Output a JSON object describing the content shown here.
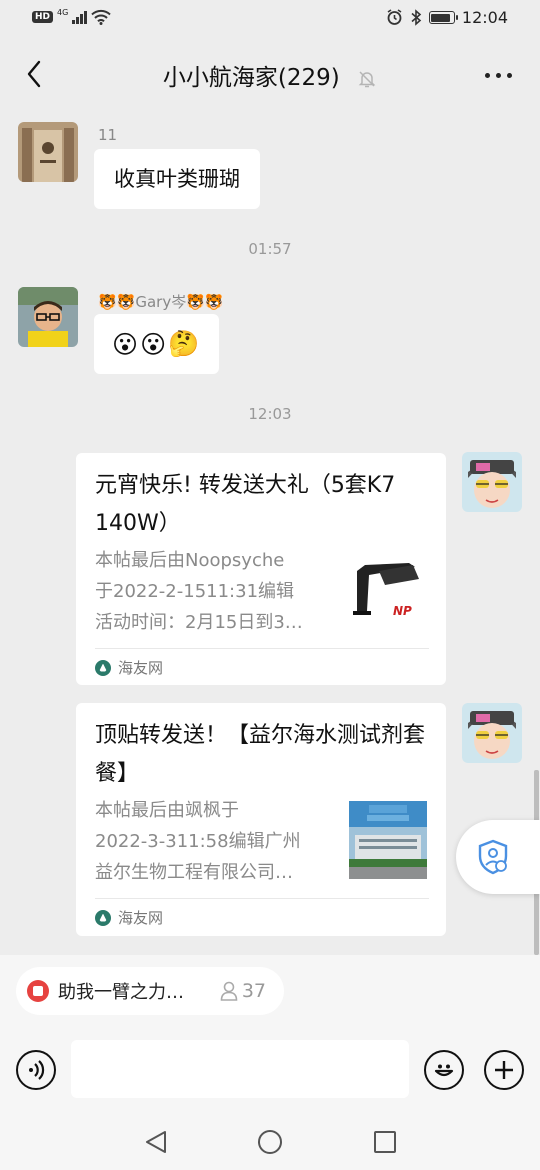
{
  "status_bar": {
    "hd": "HD",
    "network": "4G",
    "time": "12:04"
  },
  "header": {
    "title": "小小航海家(229)",
    "back_icon": "chevron-left-icon",
    "mute_icon": "bell-off-icon",
    "more_icon": "more-dots-icon"
  },
  "messages": [
    {
      "sender": "11",
      "text": "收真叶类珊瑚"
    },
    {
      "time": "01:57"
    },
    {
      "sender": "🐯🐯Gary岑🐯🐯",
      "emojis": [
        "😮",
        "😮",
        "🤔"
      ]
    },
    {
      "time": "12:03"
    }
  ],
  "cards": [
    {
      "title": "元宵快乐! 转发送大礼（5套K7  140W）",
      "desc": [
        "本帖最后由Noopsyche",
        "于2022-2-1511:31编辑",
        "活动时间：2月15日到3…"
      ],
      "source": "海友网"
    },
    {
      "title": "顶贴转发送！【益尔海水测试剂套餐】",
      "desc": [
        "本帖最后由飒枫于",
        "2022-3-311:58编辑广州",
        "益尔生物工程有限公司…"
      ],
      "source": "海友网"
    }
  ],
  "chip": {
    "label": "助我一臂之力…",
    "count": "37"
  },
  "input": {
    "placeholder": ""
  },
  "colors": {
    "background": "#ededed",
    "bubble": "#ffffff",
    "chip_icon": "#e64340",
    "source_icon": "#2b7a6a"
  }
}
